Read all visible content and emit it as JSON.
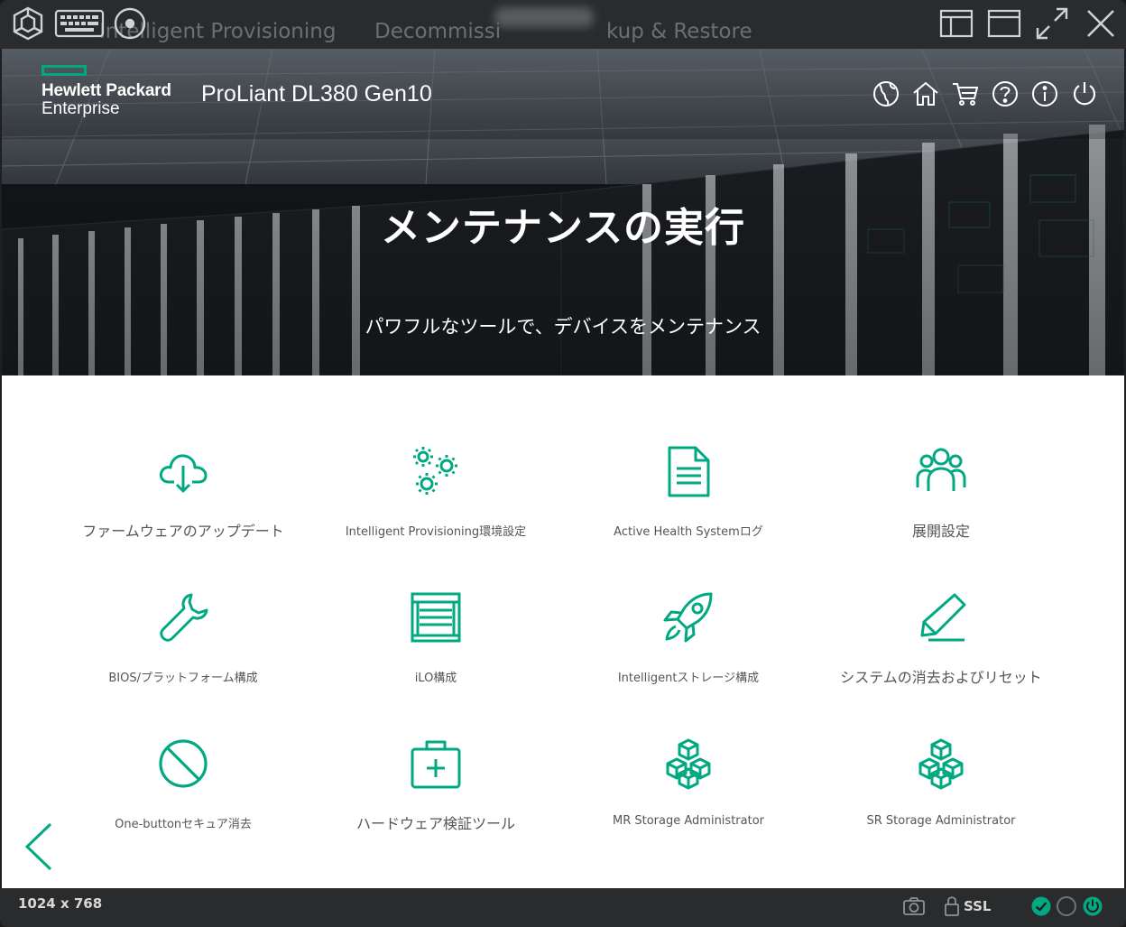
{
  "console": {
    "ghost_tabs": [
      "Intelligent Provisioning",
      "Decommissi",
      "kup & Restore"
    ],
    "icons": [
      "hexagon-icon",
      "keyboard-icon",
      "disc-icon",
      "layout-icon",
      "window-icon",
      "fullscreen-icon",
      "close-icon"
    ]
  },
  "header": {
    "brand_line1": "Hewlett Packard",
    "brand_line2": "Enterprise",
    "product": "ProLiant DL380 Gen10",
    "icons": [
      "globe-icon",
      "home-icon",
      "cart-icon",
      "help-icon",
      "info-icon",
      "power-icon"
    ]
  },
  "hero": {
    "title": "メンテナンスの実行",
    "subtitle": "パワフルなツールで、デバイスをメンテナンス"
  },
  "tiles": [
    {
      "label": "ファームウェアのアップデート",
      "icon": "cloud-download-icon"
    },
    {
      "label": "Intelligent Provisioning環境設定",
      "icon": "gears-icon"
    },
    {
      "label": "Active Health Systemログ",
      "icon": "document-icon"
    },
    {
      "label": "展開設定",
      "icon": "users-icon"
    },
    {
      "label": "BIOS/プラットフォーム構成",
      "icon": "wrench-icon"
    },
    {
      "label": "iLO構成",
      "icon": "server-rack-icon"
    },
    {
      "label": "Intelligentストレージ構成",
      "icon": "rocket-icon"
    },
    {
      "label": "システムの消去およびリセット",
      "icon": "eraser-icon"
    },
    {
      "label": "One-buttonセキュア消去",
      "icon": "prohibited-icon"
    },
    {
      "label": "ハードウェア検証ツール",
      "icon": "medkit-icon"
    },
    {
      "label": "MR Storage Administrator",
      "icon": "cubes-icon"
    },
    {
      "label": "SR Storage Administrator",
      "icon": "cubes-icon"
    }
  ],
  "status": {
    "resolution": "1024 x 768",
    "ssl": "SSL"
  },
  "colors": {
    "accent": "#01a982",
    "console_bg": "#2a2b2d"
  }
}
